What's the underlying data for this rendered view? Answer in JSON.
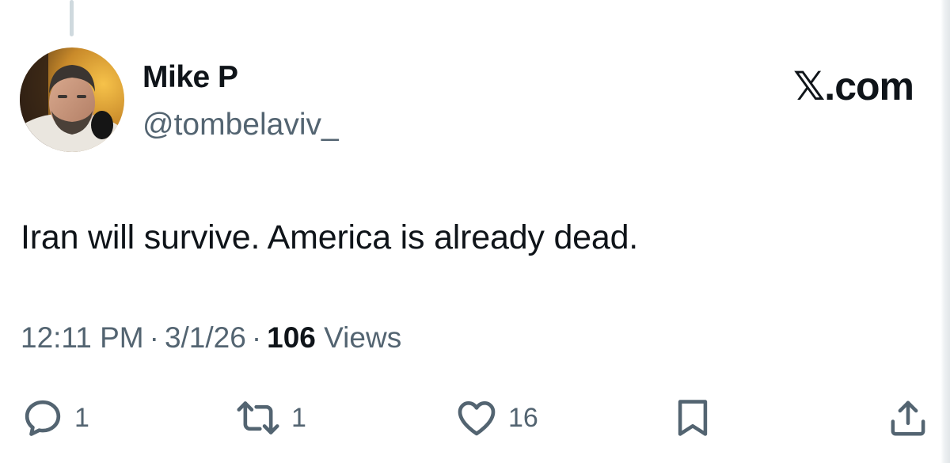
{
  "author": {
    "display_name": "Mike P",
    "handle": "@tombelaviv_"
  },
  "site": {
    "brand_label": "𝕏.com"
  },
  "tweet": {
    "text": "Iran will survive. America is already dead."
  },
  "meta": {
    "time": "12:11 PM",
    "separator": "·",
    "date": "3/1/26",
    "views_count": "106",
    "views_label": "Views"
  },
  "actions": {
    "reply": {
      "icon": "reply-icon",
      "count": "1"
    },
    "repost": {
      "icon": "repost-icon",
      "count": "1"
    },
    "like": {
      "icon": "heart-icon",
      "count": "16"
    },
    "bookmark": {
      "icon": "bookmark-icon"
    },
    "share": {
      "icon": "share-icon"
    }
  },
  "colors": {
    "text_primary": "#0f1419",
    "text_secondary": "#536471",
    "background": "#ffffff",
    "thread_line": "#cfd9de"
  }
}
